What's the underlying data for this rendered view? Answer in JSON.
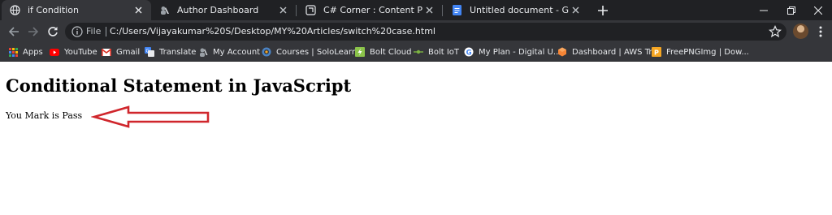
{
  "browser": {
    "tabs": [
      {
        "title": "if Condition",
        "icon": "globe-icon",
        "active": true
      },
      {
        "title": "Author Dashboard",
        "icon": "author-dashboard-icon",
        "active": false
      },
      {
        "title": "C# Corner : Content Publisher",
        "icon": "csharpcorner-icon",
        "active": false
      },
      {
        "title": "Untitled document - Google Doc",
        "icon": "google-docs-icon",
        "active": false
      }
    ],
    "address_bar": {
      "scheme_label": "File",
      "url": "C:/Users/Vijayakumar%20S/Desktop/MY%20Articles/switch%20case.html"
    },
    "bookmarks": [
      {
        "label": "Apps",
        "icon": "apps-grid-icon"
      },
      {
        "label": "YouTube",
        "icon": "youtube-icon"
      },
      {
        "label": "Gmail",
        "icon": "gmail-icon"
      },
      {
        "label": "Translate",
        "icon": "translate-icon"
      },
      {
        "label": "My Account",
        "icon": "my-account-icon"
      },
      {
        "label": "Courses | SoloLearn...",
        "icon": "sololearn-icon"
      },
      {
        "label": "Bolt Cloud",
        "icon": "bolt-cloud-icon"
      },
      {
        "label": "Bolt IoT",
        "icon": "bolt-iot-icon"
      },
      {
        "label": "My Plan - Digital U...",
        "icon": "google-icon"
      },
      {
        "label": "Dashboard | AWS Tr...",
        "icon": "aws-icon"
      },
      {
        "label": "FreePNGImg | Dow...",
        "icon": "freepngimg-icon"
      }
    ]
  },
  "page": {
    "heading": "Conditional Statement in JavaScript",
    "result_text": "You Mark is Pass"
  },
  "colors": {
    "titlebar": "#202124",
    "toolbar": "#35363a",
    "annotation_arrow": "#d0262c"
  }
}
